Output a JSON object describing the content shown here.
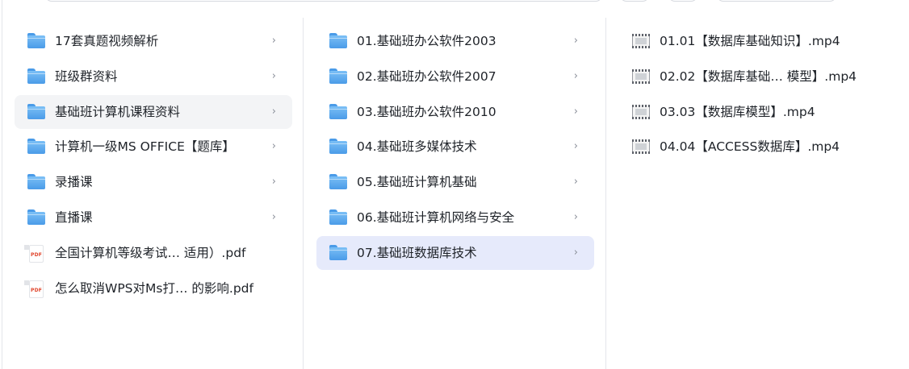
{
  "columns": [
    {
      "items": [
        {
          "label": "17套真题视频解析",
          "type": "folder",
          "icon": "folder-icon",
          "chevron": "›"
        },
        {
          "label": "班级群资料",
          "type": "folder",
          "icon": "folder-icon",
          "chevron": "›"
        },
        {
          "label": "基础班计算机课程资料",
          "type": "folder",
          "icon": "folder-icon",
          "chevron": "›",
          "state": "hover"
        },
        {
          "label": "计算机一级MS OFFICE【题库】",
          "type": "folder",
          "icon": "folder-icon",
          "chevron": "›"
        },
        {
          "label": "录播课",
          "type": "folder",
          "icon": "folder-icon",
          "chevron": "›"
        },
        {
          "label": "直播课",
          "type": "folder",
          "icon": "folder-icon",
          "chevron": "›"
        },
        {
          "label": "全国计算机等级考试…  适用）.pdf",
          "type": "pdf",
          "icon": "pdf-icon",
          "chevron": ""
        },
        {
          "label": "怎么取消WPS对Ms打… 的影响.pdf",
          "type": "pdf",
          "icon": "pdf-icon",
          "chevron": ""
        }
      ]
    },
    {
      "items": [
        {
          "label": "01.基础班办公软件2003",
          "type": "folder",
          "icon": "folder-icon",
          "chevron": "›"
        },
        {
          "label": "02.基础班办公软件2007",
          "type": "folder",
          "icon": "folder-icon",
          "chevron": "›"
        },
        {
          "label": "03.基础班办公软件2010",
          "type": "folder",
          "icon": "folder-icon",
          "chevron": "›"
        },
        {
          "label": "04.基础班多媒体技术",
          "type": "folder",
          "icon": "folder-icon",
          "chevron": "›"
        },
        {
          "label": "05.基础班计算机基础",
          "type": "folder",
          "icon": "folder-icon",
          "chevron": "›"
        },
        {
          "label": "06.基础班计算机网络与安全",
          "type": "folder",
          "icon": "folder-icon",
          "chevron": "›"
        },
        {
          "label": "07.基础班数据库技术",
          "type": "folder",
          "icon": "folder-icon",
          "chevron": "›",
          "state": "selected"
        }
      ]
    },
    {
      "items": [
        {
          "label": "01.01【数据库基础知识】.mp4",
          "type": "video",
          "icon": "video-file-icon",
          "chevron": ""
        },
        {
          "label": "02.02【数据库基础…  模型】.mp4",
          "type": "video",
          "icon": "video-file-icon",
          "chevron": ""
        },
        {
          "label": "03.03【数据库模型】.mp4",
          "type": "video",
          "icon": "video-file-icon",
          "chevron": ""
        },
        {
          "label": "04.04【ACCESS数据库】.mp4",
          "type": "video",
          "icon": "video-file-icon",
          "chevron": ""
        }
      ]
    }
  ],
  "colors": {
    "hover_bg": "#f3f4f6",
    "selected_bg": "#e6eafb",
    "folder_blue": "#4a9be8",
    "pdf_red": "#e0452c",
    "text": "#1f2329",
    "chevron": "#8a8f99"
  }
}
